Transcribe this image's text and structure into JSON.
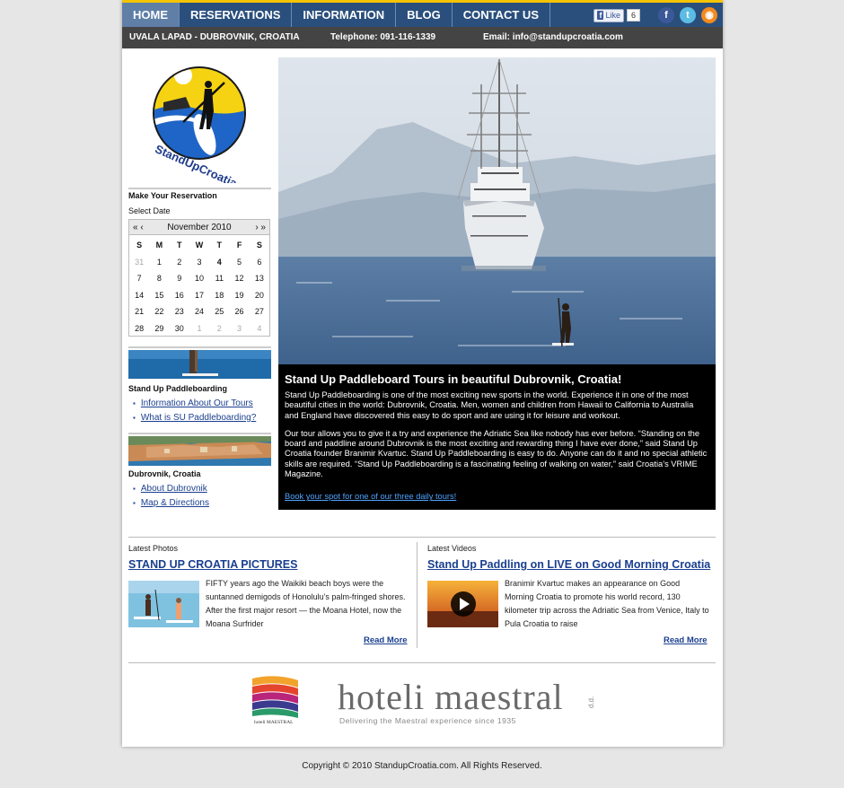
{
  "nav": {
    "items": [
      "HOME",
      "RESERVATIONS",
      "INFORMATION",
      "BLOG",
      "CONTACT US"
    ],
    "fb_like_label": "Like",
    "fb_like_count": "6"
  },
  "infobar": {
    "address": "UVALA LAPAD - DUBROVNIK, CROATIA",
    "telephone": "Telephone:  091-116-1339",
    "email": "Email:  info@standupcroatia.com"
  },
  "logo": {
    "text": "StandUpCroatia.com"
  },
  "reservation": {
    "heading": "Make Your Reservation",
    "select_date": "Select Date"
  },
  "calendar": {
    "prev": "« ‹",
    "next": "› »",
    "month": "November 2010",
    "dow": [
      "S",
      "M",
      "T",
      "W",
      "T",
      "F",
      "S"
    ],
    "weeks": [
      [
        "31",
        "1",
        "2",
        "3",
        "4",
        "5",
        "6"
      ],
      [
        "7",
        "8",
        "9",
        "10",
        "11",
        "12",
        "13"
      ],
      [
        "14",
        "15",
        "16",
        "17",
        "18",
        "19",
        "20"
      ],
      [
        "21",
        "22",
        "23",
        "24",
        "25",
        "26",
        "27"
      ],
      [
        "28",
        "29",
        "30",
        "1",
        "2",
        "3",
        "4"
      ]
    ]
  },
  "side_sup": {
    "heading": "Stand Up Paddleboarding",
    "links": [
      "Information About Our Tours",
      "What is SU Paddleboarding?"
    ]
  },
  "side_dbv": {
    "heading": "Dubrovnik, Croatia",
    "links": [
      "About Dubrovnik",
      "Map & Directions"
    ]
  },
  "hero": {
    "title": "Stand Up Paddleboard Tours in beautiful Dubrovnik, Croatia!",
    "p1": "Stand Up Paddleboarding is one of the most exciting new sports in the world. Experience it in one of the most beautiful cities in the world: Dubrovnik, Croatia. Men, women and children from Hawaii to California to Australia and England have discovered this easy to do sport and are using it for leisure and workout.",
    "p2": "Our tour allows you to give it a try and experience the Adriatic Sea like nobody has ever before. “Standing on the board and paddline around Dubrovnik is the most exciting and rewarding thing I have ever done,” said Stand Up Croatia founder Branimir Kvartuc. Stand Up Paddleboarding is easy to do. Anyone can do it and no special athletic skills are required. “Stand Up Paddleboarding is a fascinating feeling of walking on water,” said Croatia’s VRIME Magazine.",
    "link": "Book your spot for one of our three daily tours!"
  },
  "photos": {
    "label": "Latest Photos",
    "title": "STAND UP CROATIA PICTURES",
    "body": "FIFTY years ago the Waikiki beach boys were the suntanned demigods of Honolulu’s palm-fringed shores. After the first major resort — the Moana Hotel, now the Moana Surfrider",
    "read_more": "Read More"
  },
  "videos": {
    "label": "Latest Videos",
    "title": "Stand Up Paddling on LIVE on Good Morning Croatia",
    "body": "Branimir Kvartuc makes an appearance on Good Morning Croatia to promote his world record, 130 kilometer trip across the Adriatic Sea from Venice, Italy to Pula Croatia to raise",
    "read_more": "Read More"
  },
  "sponsor": {
    "small_logo_text": "hoteli MAESTRAL",
    "name": "hoteli maestral",
    "tagline": "Delivering the Maestral experience since 1935",
    "suffix": "d.d."
  },
  "footer": {
    "copyright": "Copyright © 2010 StandupCroatia.com. All Rights Reserved."
  }
}
